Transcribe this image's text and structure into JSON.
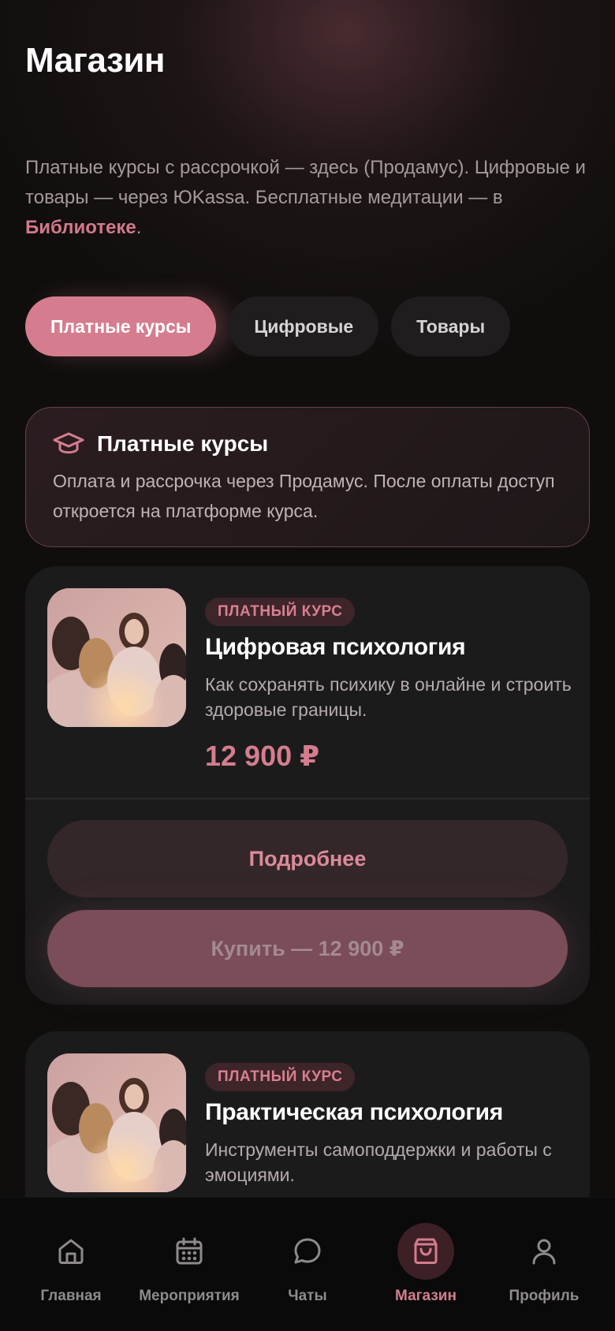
{
  "page": {
    "title": "Магазин"
  },
  "intro": {
    "text": "Платные курсы с рассрочкой — здесь (Продамус). Цифровые и товары — через ЮKassa. Бесплатные медитации — в ",
    "link": "Библиотеке",
    "end": "."
  },
  "tabs": [
    {
      "label": "Платные курсы",
      "active": true
    },
    {
      "label": "Цифровые",
      "active": false
    },
    {
      "label": "Товары",
      "active": false
    }
  ],
  "info": {
    "icon": "graduation-cap-icon",
    "title": "Платные курсы",
    "text": "Оплата и рассрочка через Продамус. После оплаты доступ откроется на платформе курса."
  },
  "courses": [
    {
      "badge": "ПЛАТНЫЙ КУРС",
      "title": "Цифровая психология",
      "description": "Как сохранять психику в онлайне и строить здоровые границы.",
      "price": "12 900 ₽",
      "more_label": "Подробнее",
      "buy_label": "Купить — 12 900 ₽"
    },
    {
      "badge": "ПЛАТНЫЙ КУРС",
      "title": "Практическая психология",
      "description": "Инструменты самоподдержки и работы с эмоциями."
    }
  ],
  "nav": [
    {
      "label": "Главная",
      "icon": "home-icon",
      "active": false
    },
    {
      "label": "Мероприятия",
      "icon": "calendar-icon",
      "active": false
    },
    {
      "label": "Чаты",
      "icon": "chat-icon",
      "active": false
    },
    {
      "label": "Магазин",
      "icon": "shopping-bag-icon",
      "active": true
    },
    {
      "label": "Профиль",
      "icon": "user-icon",
      "active": false
    }
  ],
  "colors": {
    "accent": "#d57d8e",
    "background": "#100e0d",
    "card": "#1c1b1c"
  }
}
